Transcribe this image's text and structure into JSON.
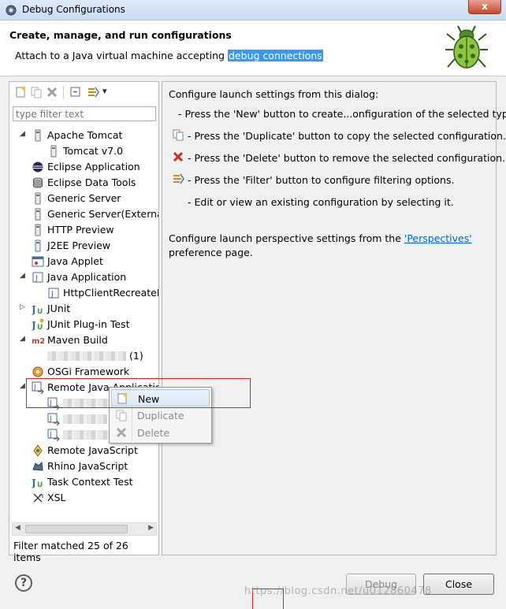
{
  "window": {
    "title": "Debug Configurations",
    "close_glyph": "x"
  },
  "header": {
    "title": "Create, manage, and run configurations",
    "message_prefix": "Attach to a Java virtual machine accepting ",
    "message_selected": "debug connections"
  },
  "toolbar": {
    "icons": [
      "new-launch-config-icon",
      "duplicate-icon",
      "delete-icon",
      "collapse-all-icon",
      "filter-icon",
      "view-menu-dropdown-icon"
    ],
    "dropdown_glyph": "▾"
  },
  "filter": {
    "placeholder": "type filter text"
  },
  "tree": {
    "items": [
      {
        "label": "Apache Tomcat",
        "icon": "tomcat-icon",
        "expanded": true
      },
      {
        "label": "Tomcat v7.0",
        "icon": "config-file-icon"
      },
      {
        "label": "Eclipse Application",
        "icon": "eclipse-icon"
      },
      {
        "label": "Eclipse Data Tools",
        "icon": "database-icon"
      },
      {
        "label": "Generic Server",
        "icon": "server-icon"
      },
      {
        "label": "Generic Server(External",
        "icon": "server-icon"
      },
      {
        "label": "HTTP Preview",
        "icon": "server-icon"
      },
      {
        "label": "J2EE Preview",
        "icon": "server-icon"
      },
      {
        "label": "Java Applet",
        "icon": "applet-icon"
      },
      {
        "label": "Java Application",
        "icon": "java-app-icon",
        "expanded": true
      },
      {
        "label": "HttpClientRecreateEx",
        "icon": "java-app-icon"
      },
      {
        "label": "JUnit",
        "icon": "junit-icon",
        "expanded": false
      },
      {
        "label": "JUnit Plug-in Test",
        "icon": "junit-plugin-icon"
      },
      {
        "label": "Maven Build",
        "icon": "maven-icon",
        "expanded": true
      },
      {
        "label": "(1)",
        "icon": "maven-config-icon",
        "blurred": true
      },
      {
        "label": "OSGi Framework",
        "icon": "osgi-icon"
      },
      {
        "label": "Remote Java Application",
        "icon": "remote-java-icon",
        "expanded": true
      },
      {
        "label": "",
        "icon": "remote-java-config-icon",
        "blurred": true
      },
      {
        "label": "",
        "icon": "remote-java-config-icon",
        "blurred": true
      },
      {
        "label": "",
        "icon": "remote-java-config-icon",
        "blurred": true
      },
      {
        "label": "Remote JavaScript",
        "icon": "remote-js-icon"
      },
      {
        "label": "Rhino JavaScript",
        "icon": "rhino-icon"
      },
      {
        "label": "Task Context Test",
        "icon": "task-context-icon"
      },
      {
        "label": "XSL",
        "icon": "xsl-icon"
      }
    ],
    "expand_glyph": "◢",
    "collapsed_glyph": "▷"
  },
  "hscroll": {
    "left_glyph": "◀",
    "right_glyph": "▶"
  },
  "filter_status": "Filter matched 25 of 26 items",
  "right": {
    "intro": "Configure launch settings from this dialog:",
    "new_line": "- Press the 'New' button to create...onfiguration of the selected type.",
    "duplicate_line": "- Press the 'Duplicate' button to copy the selected configuration.",
    "delete_line": "- Press the 'Delete' button to remove the selected configuration.",
    "filter_line": "- Press the 'Filter' button to configure filtering options.",
    "edit_line": "- Edit or view an existing configuration by selecting it.",
    "perspective_prefix": "Configure launch perspective settings from the ",
    "perspective_link": "'Perspectives'",
    "perspective_suffix": "preference page."
  },
  "context_menu": {
    "items": [
      {
        "label": "New",
        "icon": "new-icon",
        "enabled": true
      },
      {
        "label": "Duplicate",
        "icon": "duplicate-icon",
        "enabled": false
      },
      {
        "label": "Delete",
        "icon": "delete-icon",
        "enabled": false
      }
    ]
  },
  "footer": {
    "help_glyph": "?",
    "debug_label": "Debug",
    "close_label": "Close",
    "watermark": "https://blog.csdn.net/u012860478"
  },
  "colors": {
    "selection": "#3399ff",
    "link": "#0066cc",
    "annotation_red": "#e02020"
  }
}
